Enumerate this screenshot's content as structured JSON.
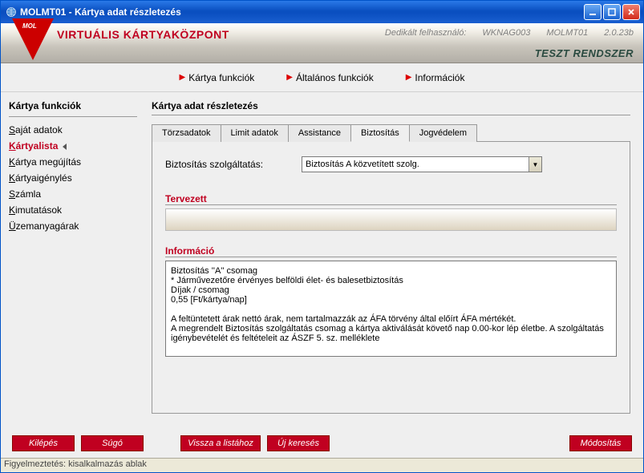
{
  "window": {
    "title": "MOLMT01 - Kártya adat részletezés"
  },
  "header": {
    "brand": "VIRTUÁLIS KÁRTYAKÖZPONT",
    "user_label": "Dedikált felhasználó:",
    "user": "WKNAG003",
    "appcode": "MOLMT01",
    "version": "2.0.23b",
    "env": "TESZT RENDSZER"
  },
  "topnav": [
    "Kártya funkciók",
    "Általános funkciók",
    "Információk"
  ],
  "sidebar": {
    "title": "Kártya funkciók",
    "items": [
      {
        "u": "S",
        "r": "aját adatok"
      },
      {
        "u": "K",
        "r": "ártyalista"
      },
      {
        "u": "K",
        "r": "ártya megújítás"
      },
      {
        "u": "K",
        "r": "ártyaigénylés"
      },
      {
        "u": "S",
        "r": "zámla"
      },
      {
        "u": "K",
        "r": "imutatások"
      },
      {
        "u": "Ü",
        "r": "zemanyagárak"
      }
    ]
  },
  "main": {
    "title": "Kártya adat részletezés",
    "tabs": [
      "Törzsadatok",
      "Limit adatok",
      "Assistance",
      "Biztosítás",
      "Jogvédelem"
    ],
    "form": {
      "service_label": "Biztosítás szolgáltatás:",
      "service_value": "Biztosítás A közvetített szolg."
    },
    "sections": {
      "planned": "Tervezett",
      "info": "Információ"
    },
    "info_text": "Biztosítás ''A'' csomag\n* Járművezetőre érvényes belföldi élet- és balesetbiztosítás\nDíjak / csomag\n0,55 [Ft/kártya/nap]\n\nA feltüntetett árak nettó árak, nem tartalmazzák az ÁFA törvény által előírt ÁFA mértékét.\nA megrendelt Biztosítás szolgáltatás csomag a kártya aktiválását követő nap 0.00-kor lép életbe. A szolgáltatás igénybevételét és feltételeit az ÁSZF 5. sz. melléklete"
  },
  "footer": {
    "exit": "Kilépés",
    "help": "Súgó",
    "back": "Vissza a listához",
    "newsearch": "Új keresés",
    "modify": "Módosítás"
  },
  "statusbar": {
    "text": "Figyelmeztetés: kisalkalmazás ablak"
  }
}
